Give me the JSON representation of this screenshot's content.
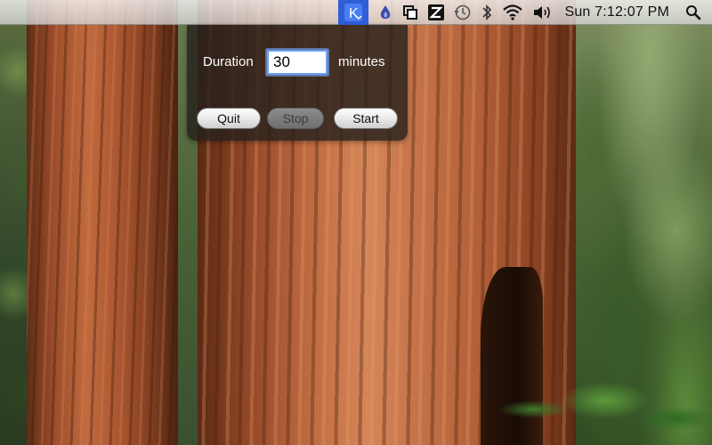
{
  "menubar": {
    "status_items": [
      {
        "icon": "k-app-icon",
        "active": true
      },
      {
        "icon": "flame-icon"
      },
      {
        "icon": "squares-icon"
      },
      {
        "icon": "z-app-icon"
      },
      {
        "icon": "time-machine-icon"
      },
      {
        "icon": "bluetooth-icon"
      },
      {
        "icon": "wifi-icon"
      },
      {
        "icon": "volume-icon"
      }
    ],
    "clock": "Sun 7:12:07 PM",
    "spotlight_icon": "magnifier-icon"
  },
  "timer_panel": {
    "duration_label": "Duration",
    "duration_value": "30",
    "unit_label": "minutes",
    "quit_label": "Quit",
    "stop_label": "Stop",
    "start_label": "Start",
    "stop_enabled": false
  },
  "colors": {
    "menubar_highlight": "#2f5ed8",
    "panel_background": "#26201c"
  }
}
